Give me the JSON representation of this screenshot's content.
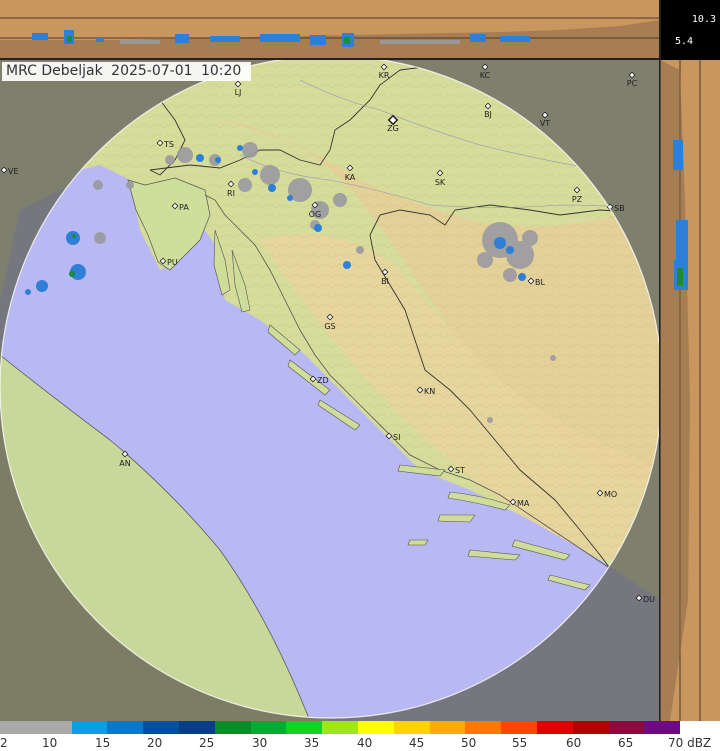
{
  "header": {
    "station": "MRC Debeljak",
    "date": "2025-07-01",
    "time": "10:20"
  },
  "altitude_scale": {
    "top": "10.3",
    "bottom": "5.4"
  },
  "cities": [
    {
      "code": "LJ"
    },
    {
      "code": "KR"
    },
    {
      "code": "KC"
    },
    {
      "code": "PC"
    },
    {
      "code": "BJ"
    },
    {
      "code": "VT"
    },
    {
      "code": "ZG"
    },
    {
      "code": "TS"
    },
    {
      "code": "VE"
    },
    {
      "code": "KA"
    },
    {
      "code": "SK"
    },
    {
      "code": "RI"
    },
    {
      "code": "PZ"
    },
    {
      "code": "SB"
    },
    {
      "code": "PA"
    },
    {
      "code": "OG"
    },
    {
      "code": "PU"
    },
    {
      "code": "BI"
    },
    {
      "code": "BL"
    },
    {
      "code": "GS"
    },
    {
      "code": "ZD"
    },
    {
      "code": "KN"
    },
    {
      "code": "SI"
    },
    {
      "code": "AN"
    },
    {
      "code": "ST"
    },
    {
      "code": "MO"
    },
    {
      "code": "MA"
    },
    {
      "code": "DU"
    }
  ],
  "legend": {
    "unit": "dBZ",
    "ticks": [
      "2",
      "10",
      "15",
      "20",
      "25",
      "30",
      "35",
      "40",
      "45",
      "50",
      "55",
      "60",
      "65",
      "70 dBZ"
    ],
    "colors": [
      "#a9a9a9",
      "#a9a9a9",
      "#0aa0e0",
      "#0a78c8",
      "#0050a0",
      "#0a3c8c",
      "#088c28",
      "#08aa32",
      "#10d228",
      "#a0e614",
      "#ffff00",
      "#ffd200",
      "#ffaa00",
      "#ff7800",
      "#ff4600",
      "#e10000",
      "#b40000",
      "#8c0a3c",
      "#6e0a82"
    ]
  },
  "colors": {
    "land": "#d6dd9a",
    "sea": "#b8b8f2",
    "mountain": "#e6cf97",
    "outside": "#8a8a7a",
    "side_panel": "#c99660",
    "echo_light": "#9a9aa0",
    "echo_blue": "#2e7fd6",
    "echo_green": "#1a8c3a"
  }
}
